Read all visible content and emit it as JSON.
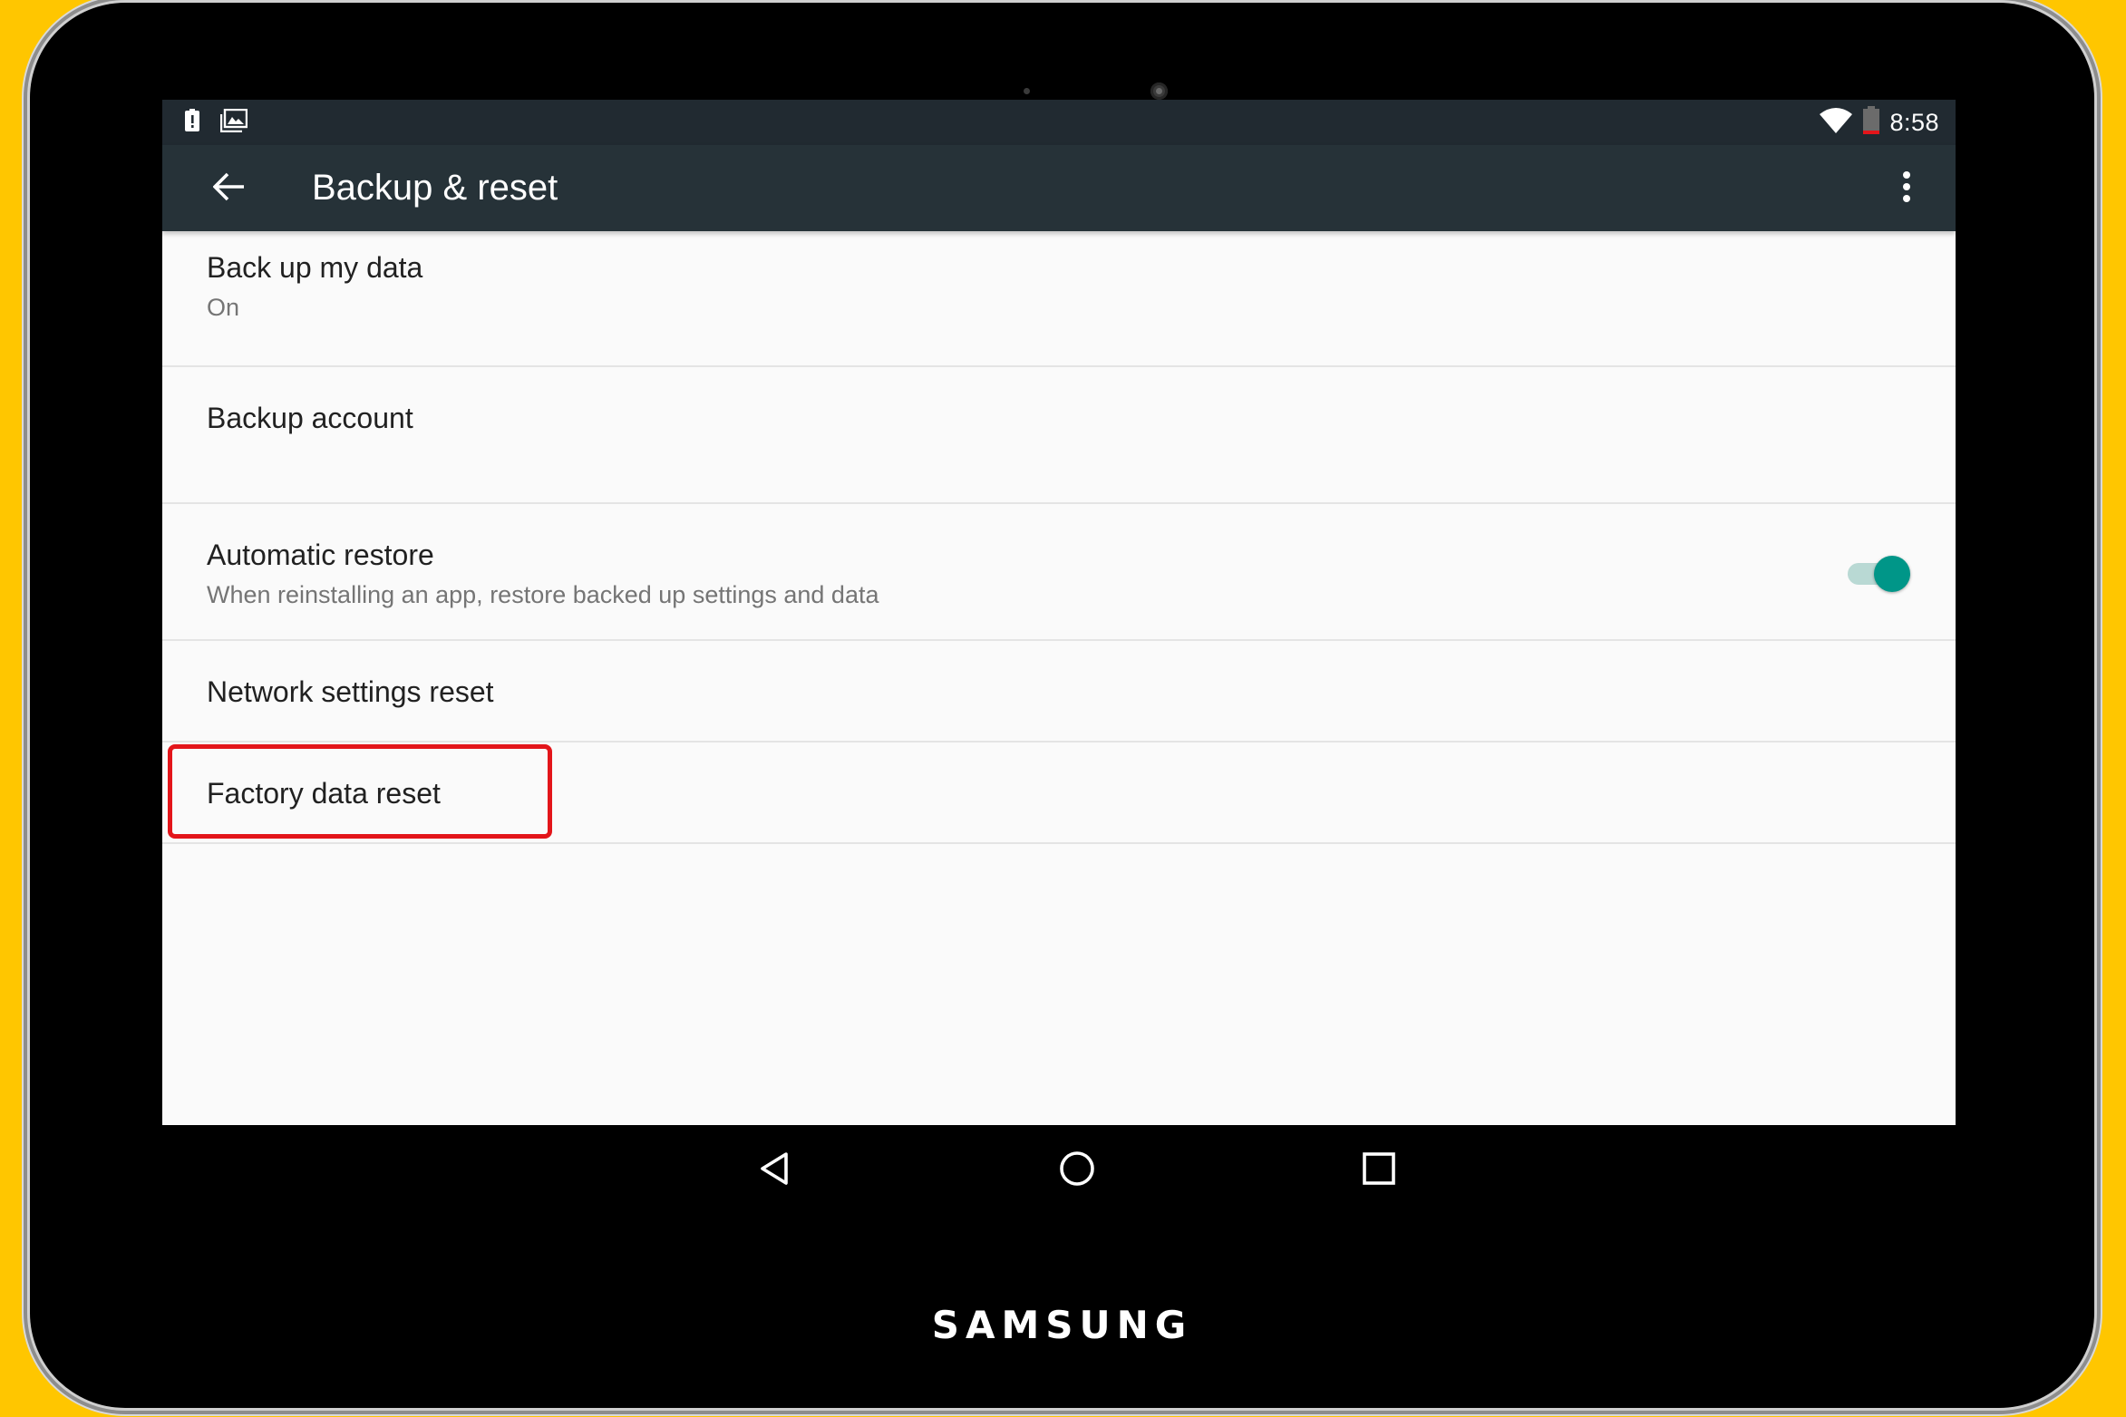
{
  "status_bar": {
    "time": "8:58",
    "left_icons": [
      "alert-icon",
      "gallery-icon"
    ],
    "right_icons": [
      "wifi-icon",
      "battery-icon"
    ]
  },
  "app_bar": {
    "title": "Backup & reset",
    "back_icon": "arrow-back-icon",
    "menu_icon": "more-vert-icon"
  },
  "settings": [
    {
      "title": "Back up my data",
      "summary": "On"
    },
    {
      "title": "Backup account",
      "summary": ""
    },
    {
      "title": "Automatic restore",
      "summary": "When reinstalling an app, restore backed up settings and data",
      "toggle": true
    },
    {
      "title": "Network settings reset",
      "summary": ""
    },
    {
      "title": "Factory data reset",
      "summary": "",
      "highlighted": true
    }
  ],
  "nav_bar": {
    "buttons": [
      "back-triangle-icon",
      "home-circle-icon",
      "recents-square-icon"
    ]
  },
  "device": {
    "brand": "SAMSUNG"
  },
  "colors": {
    "background": "#FFC600",
    "app_bar": "#263238",
    "status_bar": "#212A31",
    "accent": "#009688",
    "highlight": "#E3151A"
  }
}
